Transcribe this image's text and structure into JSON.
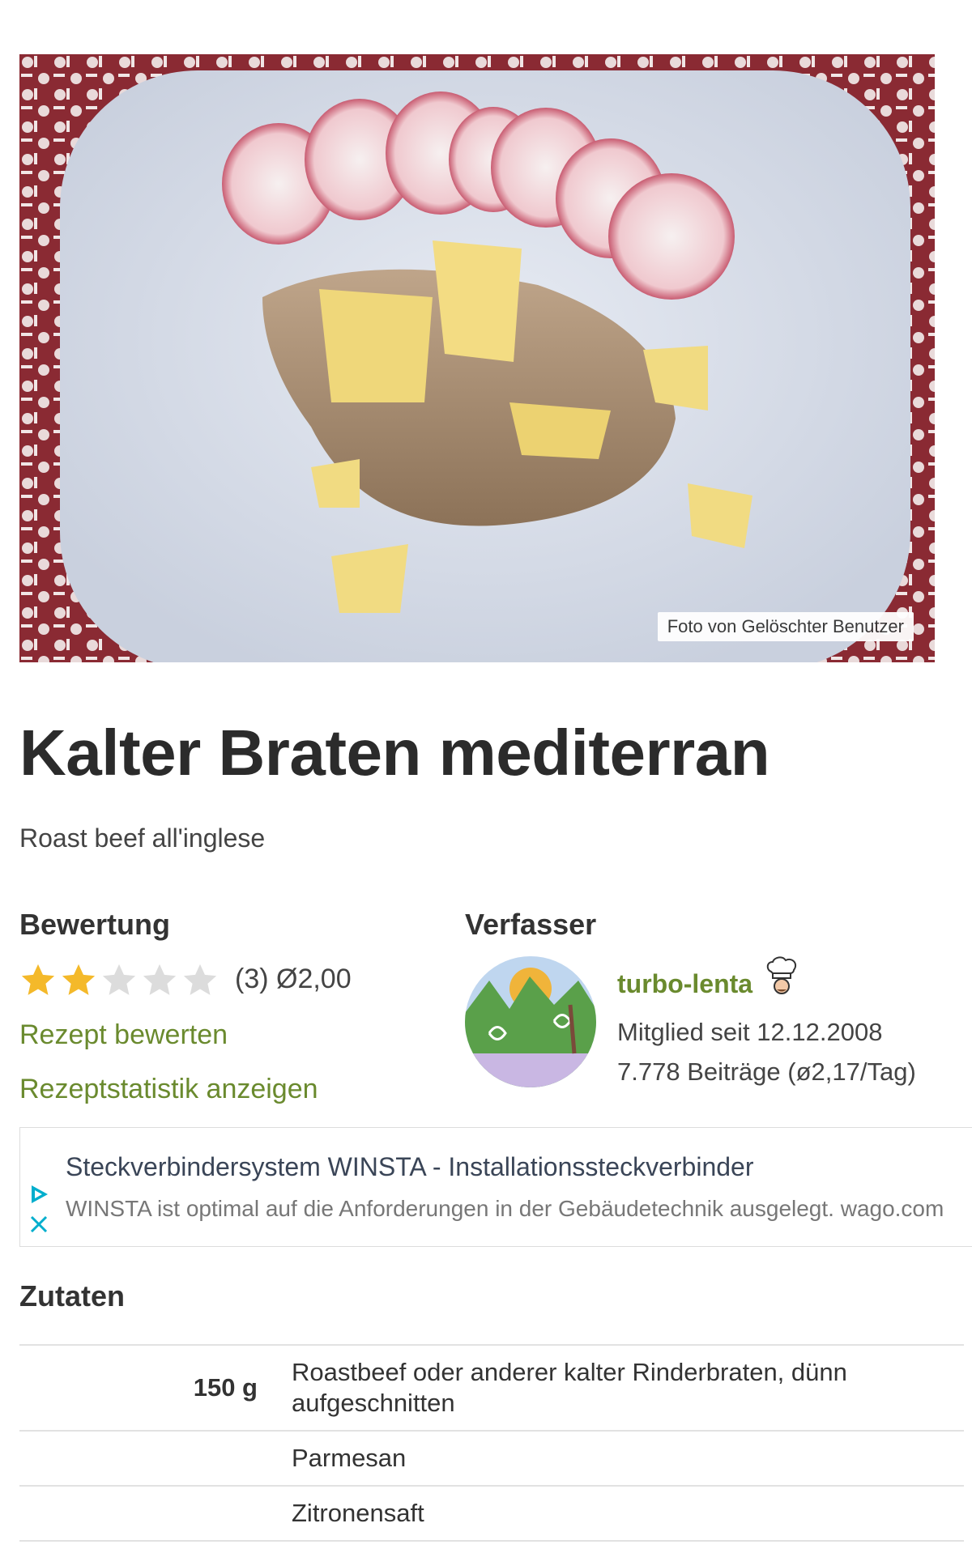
{
  "hero": {
    "photo_credit": "Foto von Gelöschter Benutzer"
  },
  "recipe": {
    "title": "Kalter Braten mediterran",
    "subtitle": "Roast beef all'inglese"
  },
  "rating": {
    "heading": "Bewertung",
    "stars_filled": 2,
    "stars_total": 5,
    "summary": "(3) Ø2,00",
    "rate_link": "Rezept bewerten",
    "stats_link": "Rezeptstatistik anzeigen"
  },
  "author": {
    "heading": "Verfasser",
    "name": "turbo-lenta",
    "member_since": "Mitglied seit 12.12.2008",
    "posts": "7.778 Beiträge (ø2,17/Tag)",
    "badge_icon": "chef-hat-icon"
  },
  "ad": {
    "title": "Steckverbindersystem WINSTA - Installationssteckverbinder",
    "text": "WINSTA ist optimal auf die Anforderungen in der Gebäudetechnik ausgelegt. wago.com"
  },
  "ingredients": {
    "heading": "Zutaten",
    "rows": [
      {
        "amount": "150 g",
        "name": "Roastbeef oder anderer kalter Rinderbraten, dünn aufgeschnitten"
      },
      {
        "amount": "",
        "name": "Parmesan"
      },
      {
        "amount": "",
        "name": "Zitronensaft"
      }
    ]
  },
  "colors": {
    "link_green": "#6a8a2e",
    "star_gold": "#f4b92a",
    "star_empty": "#dcdcdc",
    "ad_icon_blue": "#00aecd"
  }
}
